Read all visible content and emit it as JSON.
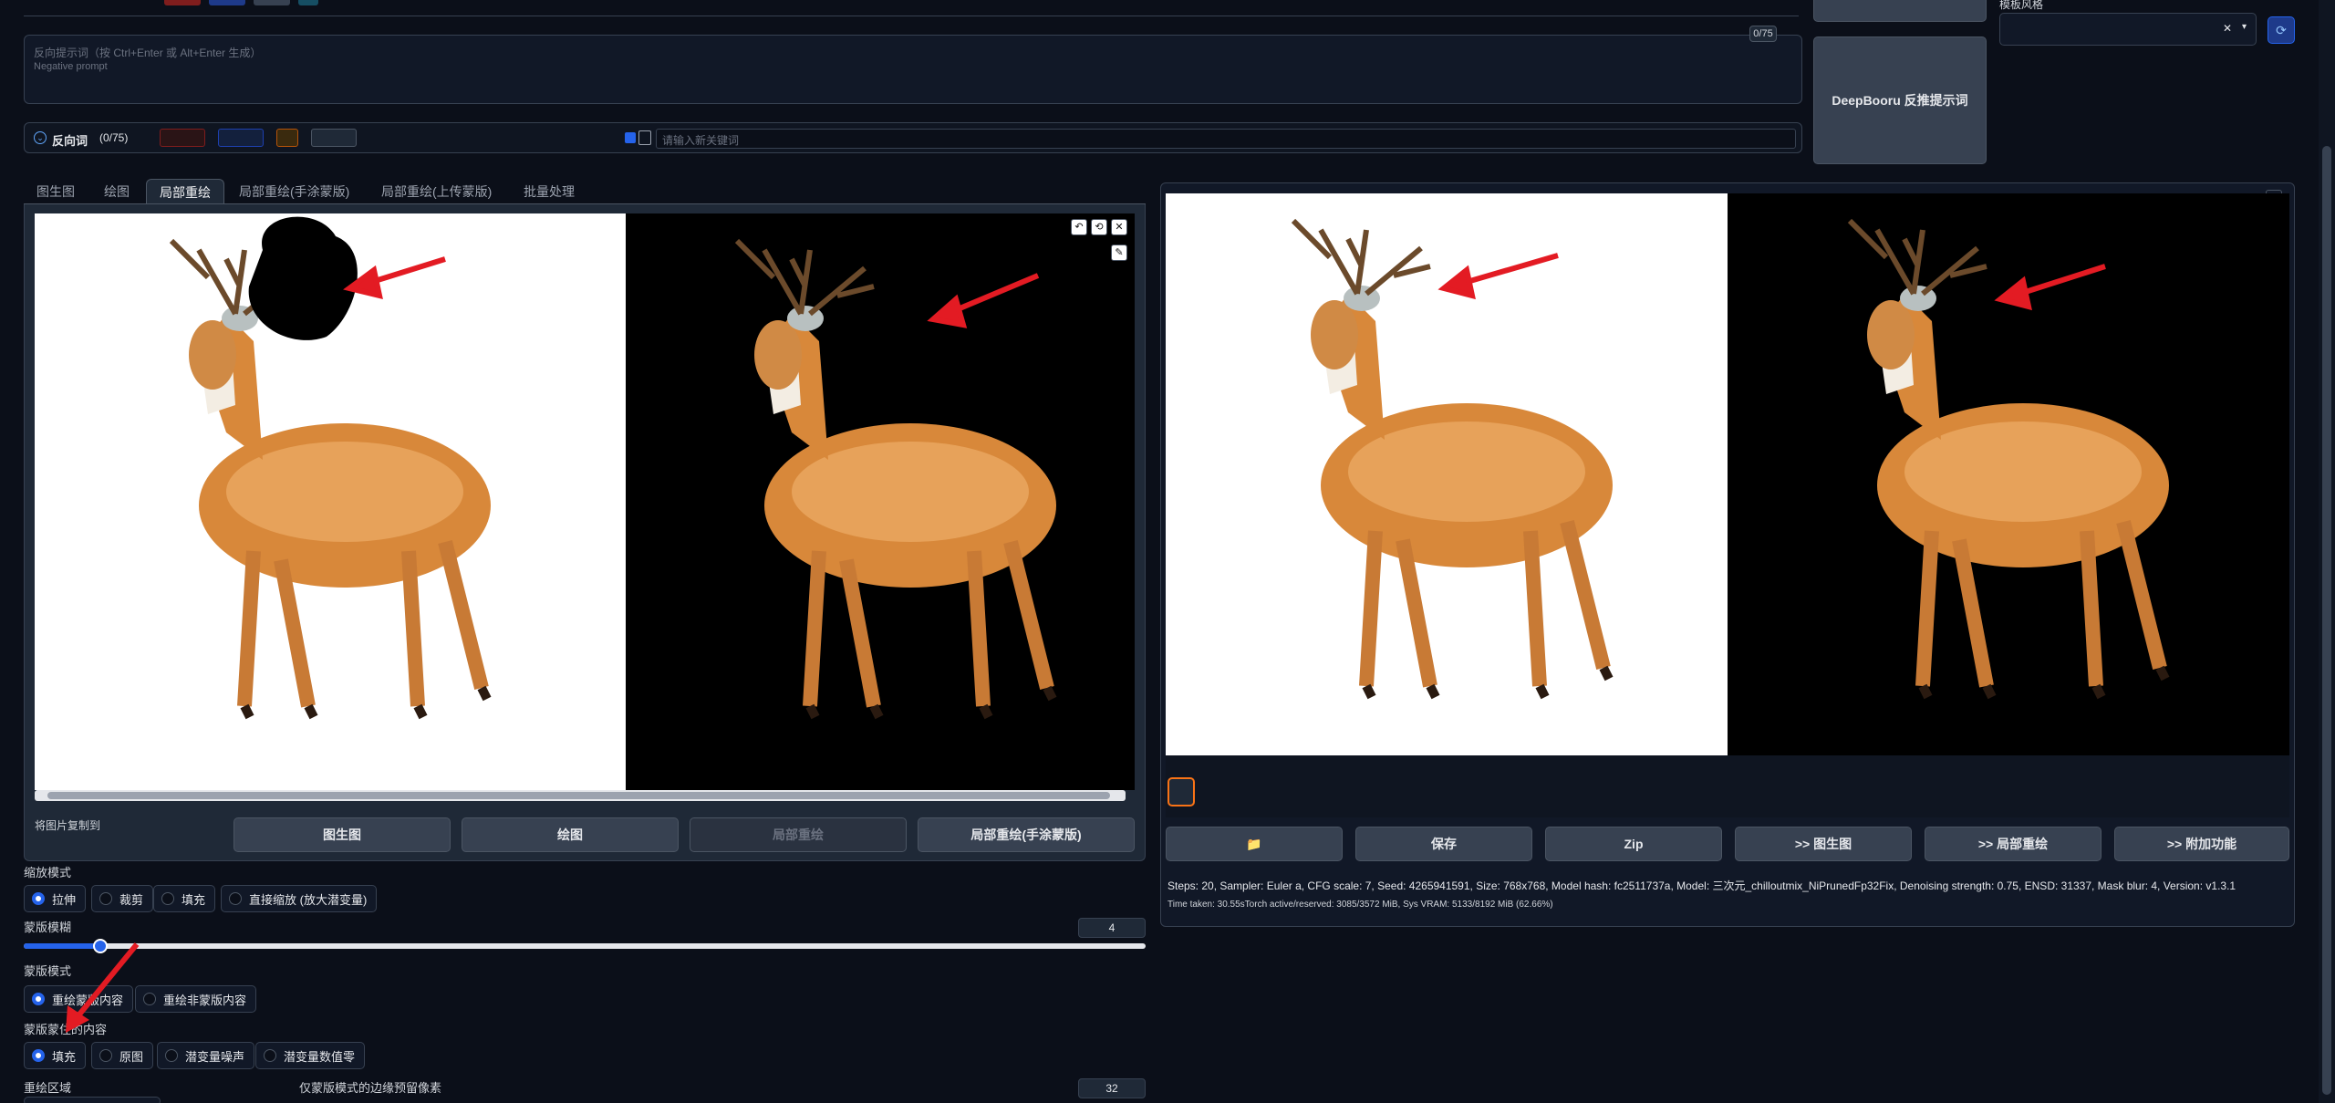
{
  "top": {
    "neg_placeholder": "反向提示词（按 Ctrl+Enter 或 Alt+Enter 生成）",
    "neg_placeholder_en": "Negative prompt",
    "neg_counter": "0/75",
    "deepbooru_label": "DeepBooru 反推提示词",
    "style_label": "模板风格",
    "style_clear": "✕",
    "neg_section_label": "反向词",
    "neg_section_count": "(0/75)",
    "keyword_placeholder": "请输入新关键词"
  },
  "tabs": [
    {
      "label": "图生图"
    },
    {
      "label": "绘图"
    },
    {
      "label": "局部重绘"
    },
    {
      "label": "局部重绘(手涂蒙版)"
    },
    {
      "label": "局部重绘(上传蒙版)"
    },
    {
      "label": "批量处理"
    }
  ],
  "copy_to": {
    "label": "将图片复制到",
    "buttons": [
      "图生图",
      "绘图",
      "局部重绘",
      "局部重绘(手涂蒙版)"
    ]
  },
  "resize_mode": {
    "label": "缩放模式",
    "options": [
      "拉伸",
      "裁剪",
      "填充",
      "直接缩放 (放大潜变量)"
    ],
    "selected": "拉伸"
  },
  "mask_blur": {
    "label": "蒙版模糊",
    "value": "4",
    "fraction": 0.068
  },
  "mask_mode": {
    "label": "蒙版模式",
    "options": [
      "重绘蒙版内容",
      "重绘非蒙版内容"
    ],
    "selected": "重绘蒙版内容"
  },
  "masked_content": {
    "label": "蒙版蒙住的内容",
    "options": [
      "填充",
      "原图",
      "潜变量噪声",
      "潜变量数值零"
    ],
    "selected": "填充"
  },
  "inpaint_area": {
    "label": "重绘区域"
  },
  "only_masked_padding": {
    "label": "仅蒙版模式的边缘预留像素",
    "value": "32"
  },
  "output_buttons": [
    "📁",
    "保存",
    "Zip",
    ">> 图生图",
    ">> 局部重绘",
    ">> 附加功能"
  ],
  "generation_info": "Steps: 20, Sampler: Euler a, CFG scale: 7, Seed: 4265941591, Size: 768x768, Model hash: fc2511737a, Model: 三次元_chilloutmix_NiPrunedFp32Fix, Denoising strength: 0.75, ENSD: 31337, Mask blur: 4, Version: v1.3.1",
  "time_info": "Time taken: 30.55sTorch active/reserved: 3085/3572 MiB, Sys VRAM: 5133/8192 MiB (62.66%)",
  "colors": {
    "accent": "#2563eb",
    "bg": "#0b0f19",
    "panel": "#1f2937",
    "arrow": "#e31b23"
  }
}
